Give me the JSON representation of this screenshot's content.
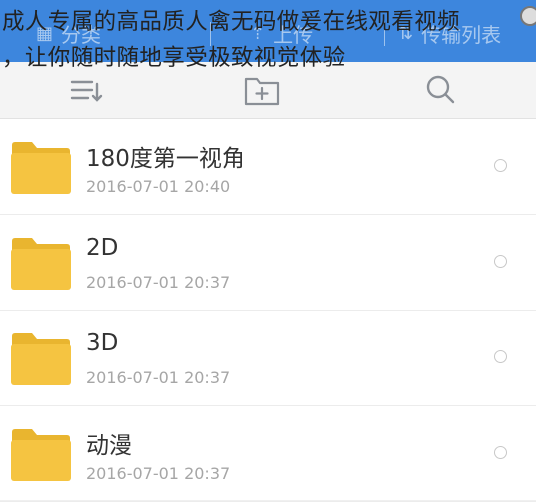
{
  "overlay": {
    "line1": "成人专属的高品质人禽无码做爰在线观看视频",
    "line2": "，让你随时随地享受极致视觉体验"
  },
  "tabs": [
    {
      "label": "分类",
      "icon": "category-icon"
    },
    {
      "label": "上传",
      "icon": "upload-icon"
    },
    {
      "label": "传输列表",
      "icon": "transfer-icon"
    }
  ],
  "toolbar": {
    "icons": [
      "sort-list-icon",
      "new-folder-icon",
      "search-icon"
    ]
  },
  "files": [
    {
      "name": "180度第一视角",
      "date": "2016-07-01  20:40"
    },
    {
      "name": "2D",
      "date": "2016-07-01  20:37"
    },
    {
      "name": "3D",
      "date": "2016-07-01  20:37"
    },
    {
      "name": "动漫",
      "date": "2016-07-01  20:37"
    }
  ],
  "colors": {
    "accent": "#3d86dd",
    "folder": "#f5c441",
    "folder_tab": "#e9b52f"
  }
}
